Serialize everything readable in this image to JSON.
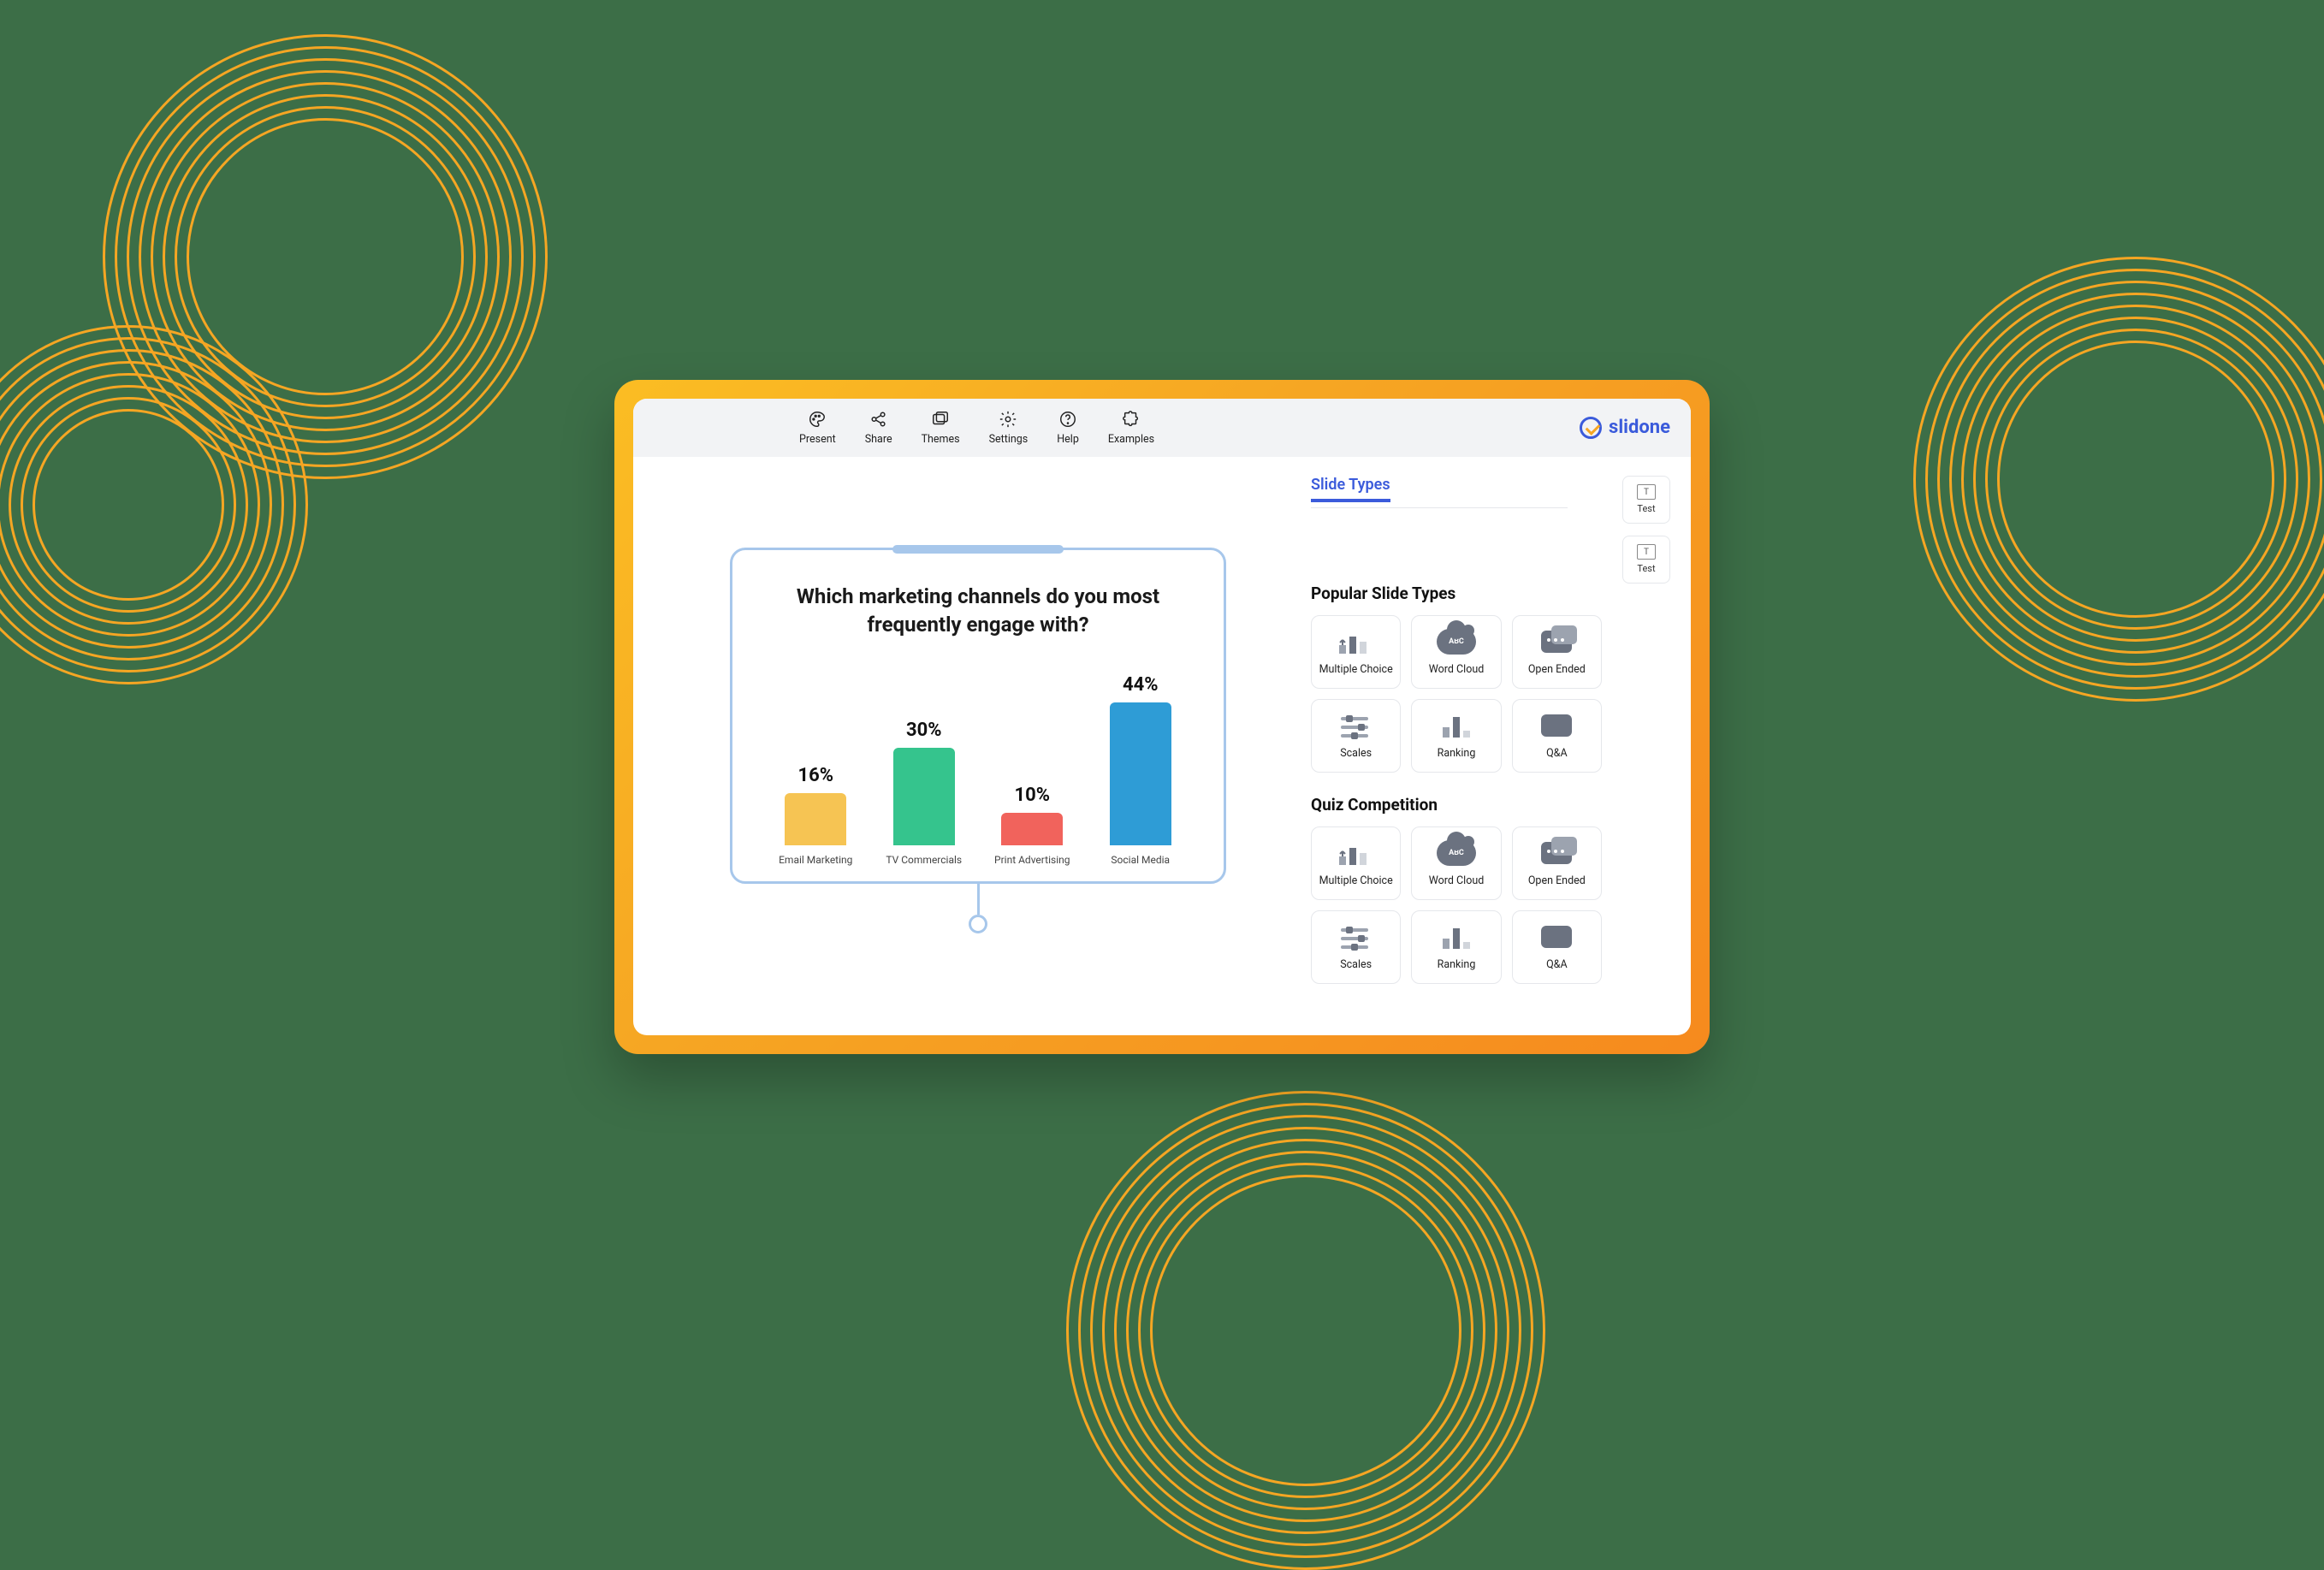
{
  "brand": {
    "name": "slidone"
  },
  "toolbar": {
    "items": [
      {
        "label": "Present"
      },
      {
        "label": "Share"
      },
      {
        "label": "Themes"
      },
      {
        "label": "Settings"
      },
      {
        "label": "Help"
      },
      {
        "label": "Examples"
      }
    ]
  },
  "panel": {
    "tab_label": "Slide Types",
    "side_tiles": [
      {
        "label": "Test"
      },
      {
        "label": "Test"
      }
    ],
    "sections": [
      {
        "title": "Popular Slide Types",
        "items": [
          {
            "label": "Multiple Choice",
            "icon": "multiple-choice"
          },
          {
            "label": "Word Cloud",
            "icon": "word-cloud",
            "badge": "ABC"
          },
          {
            "label": "Open Ended",
            "icon": "open-ended"
          },
          {
            "label": "Scales",
            "icon": "scales"
          },
          {
            "label": "Ranking",
            "icon": "ranking"
          },
          {
            "label": "Q&A",
            "icon": "qa"
          }
        ]
      },
      {
        "title": "Quiz Competition",
        "items": [
          {
            "label": "Multiple Choice",
            "icon": "multiple-choice"
          },
          {
            "label": "Word Cloud",
            "icon": "word-cloud",
            "badge": "ABC"
          },
          {
            "label": "Open Ended",
            "icon": "open-ended"
          },
          {
            "label": "Scales",
            "icon": "scales"
          },
          {
            "label": "Ranking",
            "icon": "ranking"
          },
          {
            "label": "Q&A",
            "icon": "qa"
          }
        ]
      }
    ]
  },
  "slide": {
    "question": "Which marketing channels do you most frequently engage with?"
  },
  "chart_data": {
    "type": "bar",
    "title": "Which marketing channels do you most frequently engage with?",
    "categories": [
      "Email Marketing",
      "TV Commercials",
      "Print Advertising",
      "Social Media"
    ],
    "values": [
      16,
      30,
      10,
      44
    ],
    "value_suffix": "%",
    "ylim": [
      0,
      50
    ],
    "colors": [
      "#f6c453",
      "#35c48d",
      "#f1635c",
      "#2e9cd6"
    ]
  }
}
